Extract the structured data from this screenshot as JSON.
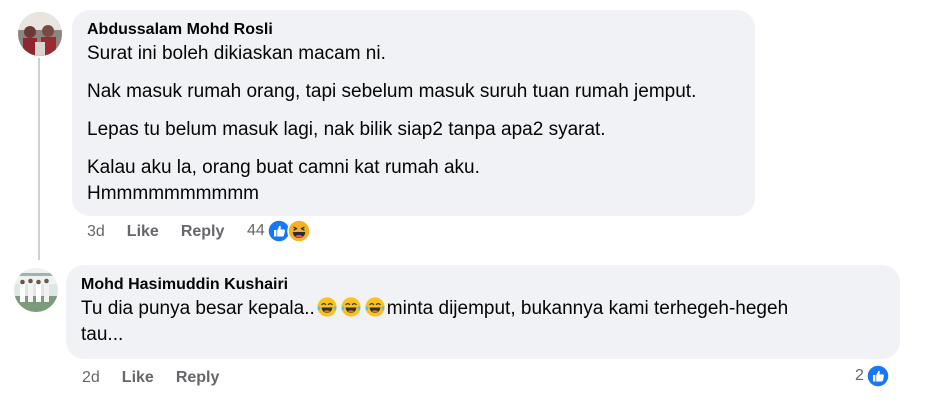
{
  "comments": [
    {
      "author": "Abdussalam Mohd Rosli",
      "lines": [
        "Surat ini boleh dikiaskan macam ni.",
        "Nak masuk rumah orang, tapi sebelum masuk suruh tuan rumah jemput.",
        "Lepas tu belum masuk lagi, nak bilik siap2 tanpa apa2 syarat.",
        "Kalau aku la, orang buat camni kat rumah aku.",
        "Hmmmmmmmmmm"
      ],
      "time": "3d",
      "like_label": "Like",
      "reply_label": "Reply",
      "reaction_count": "44",
      "reactions": [
        "like-icon",
        "haha-icon"
      ]
    },
    {
      "author": "Mohd Hasimuddin Kushairi",
      "text_before": "Tu dia punya besar kepala..",
      "inline_emojis": [
        "laughing-tears-icon",
        "laughing-tears-icon",
        "laughing-tears-icon"
      ],
      "text_after": "minta dijemput, bukannya kami terhegeh-hegeh",
      "line2": "tau...",
      "time": "2d",
      "like_label": "Like",
      "reply_label": "Reply",
      "reaction_count": "2",
      "reactions": [
        "like-icon"
      ]
    }
  ],
  "colors": {
    "bubble": "#f0f2f5",
    "secondary_text": "#65676b",
    "like_blue": "#1877f2",
    "haha_yellow": "#f7b125"
  }
}
